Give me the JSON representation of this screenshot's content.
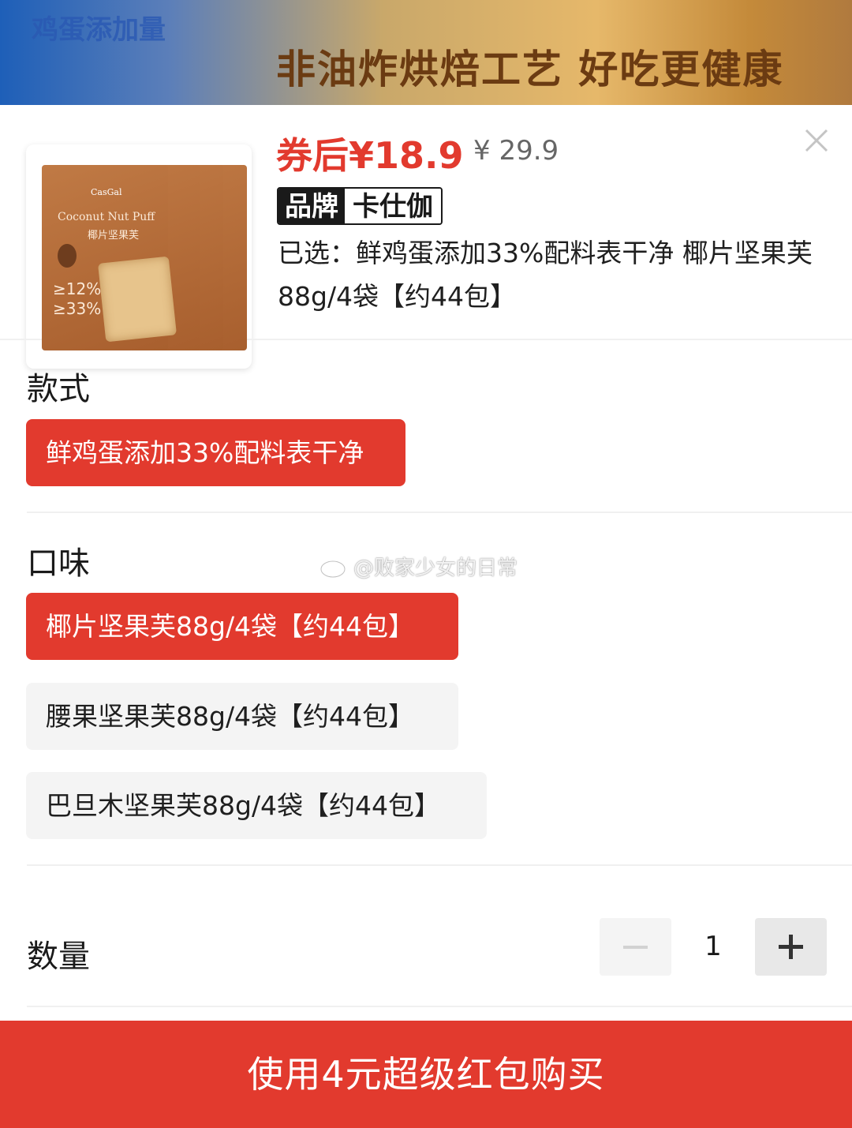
{
  "banner": {
    "top_text": "鸡蛋添加量",
    "slogan": "非油炸烘焙工艺 好吃更健康"
  },
  "product": {
    "image": {
      "brand": "CasGal",
      "name": "Coconut Nut Puff",
      "name_cn": "椰片坚果芙",
      "pct_1": "≥12%",
      "pct_2": "≥33%"
    },
    "price_after_coupon": "券后¥18.9",
    "original_price": "¥ 29.9",
    "brand_key": "品牌",
    "brand_value": "卡仕伽",
    "selected": "已选：鲜鸡蛋添加33%配料表干净 椰片坚果芙88g/4袋【约44包】"
  },
  "sections": {
    "style_title": "款式",
    "flavor_title": "口味",
    "qty_title": "数量"
  },
  "style_options": [
    {
      "label": "鲜鸡蛋添加33%配料表干净",
      "selected": true
    }
  ],
  "flavor_options": [
    {
      "label": "椰片坚果芙88g/4袋【约44包】",
      "selected": true
    },
    {
      "label": "腰果坚果芙88g/4袋【约44包】",
      "selected": false
    },
    {
      "label": "巴旦木坚果芙88g/4袋【约44包】",
      "selected": false
    }
  ],
  "quantity": {
    "value": "1"
  },
  "watermark": "@败家少女的日常",
  "buy_button": "使用4元超级红包购买",
  "colors": {
    "accent": "#e23a2e",
    "chip_bg": "#f4f4f4"
  },
  "icons": {
    "close": "close-icon",
    "minus": "minus-icon",
    "plus": "plus-icon",
    "weibo": "weibo-icon"
  }
}
